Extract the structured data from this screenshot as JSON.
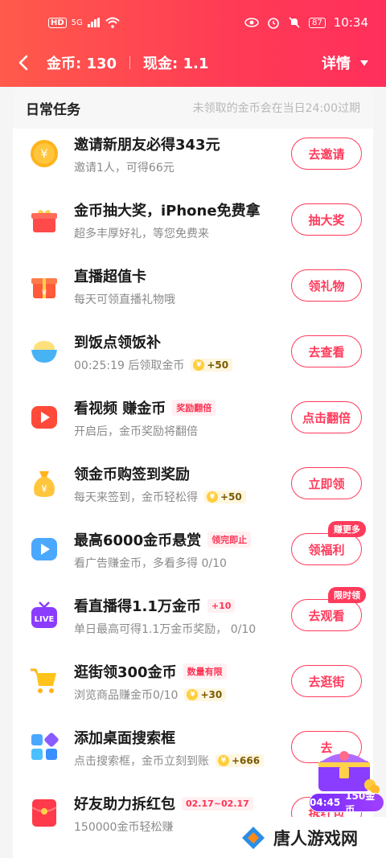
{
  "status": {
    "hd": "HD",
    "network": "5G",
    "battery": "87",
    "time": "10:34"
  },
  "nav": {
    "coins_label": "金币: 130",
    "cash_label": "现金: 1.1",
    "detail_label": "详情"
  },
  "section": {
    "title": "日常任务",
    "note": "未领取的金币会在当日24:00过期"
  },
  "tasks": [
    {
      "title": "邀请新朋友必得343元",
      "sub": "邀请1人，可得66元",
      "action": "去邀请",
      "icon": "coin-yuan-icon"
    },
    {
      "title": "金币抽大奖，iPhone免费拿",
      "sub": "超多丰厚好礼，等您免费来",
      "action": "抽大奖",
      "icon": "gift-box-icon"
    },
    {
      "title": "直播超值卡",
      "sub": "每天可领直播礼物哦",
      "action": "领礼物",
      "icon": "red-gift-icon"
    },
    {
      "title": "到饭点领饭补",
      "sub": "00:25:19 后领取金币",
      "coin": "+50",
      "action": "去查看",
      "icon": "rice-bowl-icon"
    },
    {
      "title": "看视频 赚金币",
      "tag": "奖励翻倍",
      "sub": "开启后，金币奖励将翻倍",
      "action": "点击翻倍",
      "icon": "video-play-icon"
    },
    {
      "title": "领金币购签到奖励",
      "sub": "每天来签到，金币轻松得",
      "coin": "+50",
      "action": "立即领",
      "icon": "money-bag-icon"
    },
    {
      "title": "最高6000金币悬赏",
      "tag": "领完即止",
      "sub": "看广告赚金币，多看多得 0/10",
      "action": "领福利",
      "badge": "赚更多",
      "icon": "ad-play-icon"
    },
    {
      "title": "看直播得1.1万金币",
      "tag": "+10",
      "sub": "单日最高可得1.1万金币奖励，   0/10",
      "action": "去观看",
      "badge": "限时领",
      "icon": "live-tv-icon"
    },
    {
      "title": "逛街领300金币",
      "tag": "数量有限",
      "sub": "浏览商品赚金币0/10",
      "coin": "+30",
      "action": "去逛街",
      "icon": "shopping-cart-icon"
    },
    {
      "title": "添加桌面搜索框",
      "sub": "点击搜索框，金币立刻到账",
      "coin": "+666",
      "action": "去",
      "icon": "apps-grid-icon"
    },
    {
      "title": "好友助力拆红包",
      "tag": "02.17~02.17",
      "sub": "150000金币轻松赚",
      "action": "拆红包",
      "icon": "red-envelope-icon"
    }
  ],
  "floating": {
    "timer": "04:45",
    "amount": "150金币"
  },
  "watermark": {
    "text": "唐人游戏网"
  },
  "colors": {
    "brand": "#ff3b5c",
    "header_start": "#ff5a4b"
  }
}
